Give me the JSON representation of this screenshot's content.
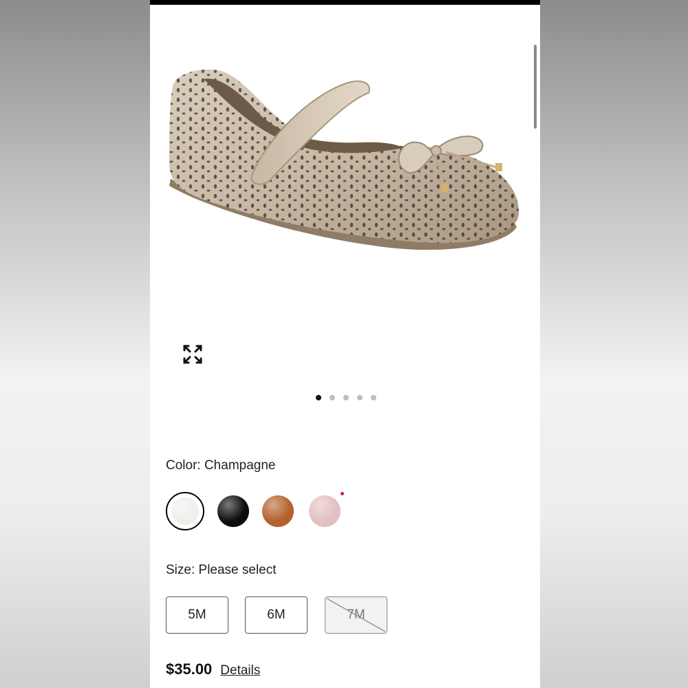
{
  "product": {
    "image_alt": "Champagne perforated Mary Jane flat with bow",
    "gallery_dots": [
      {
        "active": true
      },
      {
        "active": false
      },
      {
        "active": false
      },
      {
        "active": false
      },
      {
        "active": false
      }
    ]
  },
  "color": {
    "label": "Color: Champagne",
    "swatches": [
      {
        "name": "Champagne",
        "color": "#f1efec",
        "selected": true
      },
      {
        "name": "Black",
        "color": "#0d0d0d",
        "selected": false
      },
      {
        "name": "Bronze",
        "color": "#b5622d",
        "selected": false
      },
      {
        "name": "Pink",
        "color": "#e2c0c2",
        "selected": false,
        "badge_color": "#d12030"
      }
    ]
  },
  "size": {
    "label": "Size: Please select",
    "options": [
      {
        "label": "5M",
        "available": true
      },
      {
        "label": "6M",
        "available": true
      },
      {
        "label": "7M",
        "available": false
      }
    ]
  },
  "price": {
    "amount": "$35.00",
    "details_label": "Details"
  },
  "icons": {
    "expand": "expand-icon"
  }
}
